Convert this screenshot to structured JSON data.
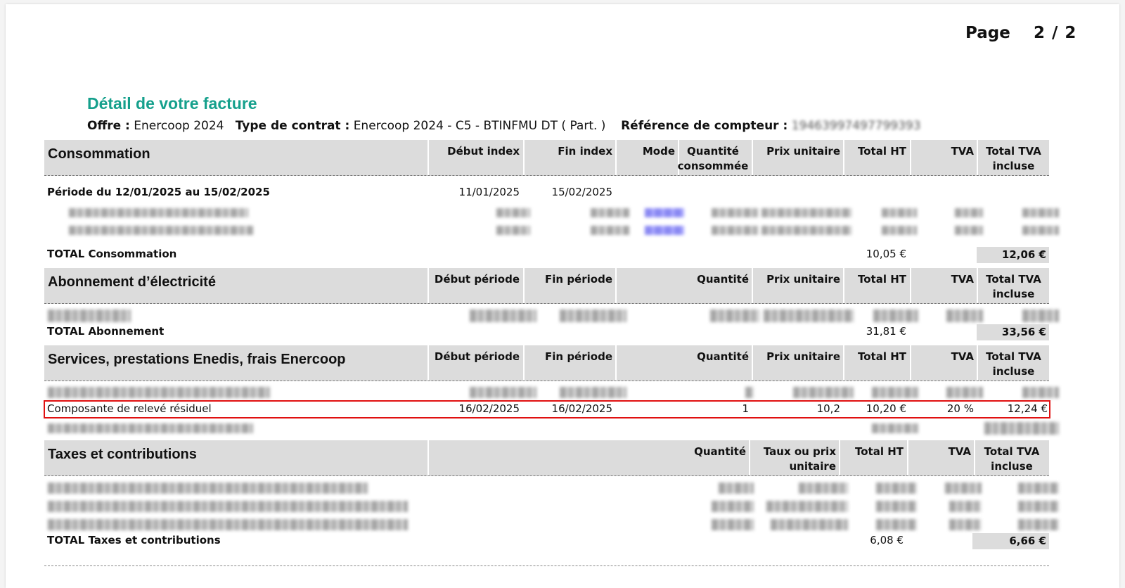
{
  "page": {
    "label": "Page",
    "number": "2 / 2"
  },
  "title": "Détail de votre facture",
  "offer": {
    "offre_label": "Offre :",
    "offre_value": "Enercoop 2024",
    "contrat_label": "Type de contrat :",
    "contrat_value": "Enercoop 2024 - C5 - BTINFMU DT ( Part. )",
    "compteur_label": "Référence de compteur :",
    "compteur_value": "19463997497799393"
  },
  "consommation": {
    "title": "Consommation",
    "headers": {
      "debut": "Début index",
      "fin": "Fin index",
      "mode": "Mode",
      "quantite": "Quantité consommée",
      "prix": "Prix unitaire",
      "total_ht": "Total HT",
      "tva": "TVA",
      "total_ttc": "Total TVA incluse"
    },
    "periode": {
      "label": "Période du 12/01/2025 au 15/02/2025",
      "debut": "11/01/2025",
      "fin": "15/02/2025"
    },
    "total": {
      "label": "TOTAL Consommation",
      "ht": "10,05 €",
      "ttc": "12,06 €"
    }
  },
  "abonnement": {
    "title": "Abonnement d’électricité",
    "headers": {
      "debut": "Début période",
      "fin": "Fin période",
      "quantite": "Quantité",
      "prix": "Prix unitaire",
      "total_ht": "Total HT",
      "tva": "TVA",
      "total_ttc": "Total TVA incluse"
    },
    "total": {
      "label": "TOTAL Abonnement",
      "ht": "31,81 €",
      "ttc": "33,56 €"
    }
  },
  "services": {
    "title": "Services, prestations Enedis, frais Enercoop",
    "headers": {
      "debut": "Début période",
      "fin": "Fin période",
      "quantite": "Quantité",
      "prix": "Prix unitaire",
      "total_ht": "Total HT",
      "tva": "TVA",
      "total_ttc": "Total TVA incluse"
    },
    "highlighted_row": {
      "label": "Composante de relevé résiduel",
      "debut": "16/02/2025",
      "fin": "16/02/2025",
      "quantite": "1",
      "prix": "10,2",
      "total_ht": "10,20 €",
      "tva": "20 %",
      "total_ttc": "12,24 €"
    }
  },
  "taxes": {
    "title": "Taxes et contributions",
    "headers": {
      "quantite": "Quantité",
      "taux": "Taux ou prix unitaire",
      "total_ht": "Total HT",
      "tva": "TVA",
      "total_ttc": "Total TVA incluse"
    },
    "total": {
      "label": "TOTAL Taxes et contributions",
      "ht": "6,08 €",
      "ttc": "6,66 €"
    }
  },
  "colors": {
    "accent": "#15a08c",
    "highlight": "#e01010",
    "band": "#dcdcdc"
  }
}
